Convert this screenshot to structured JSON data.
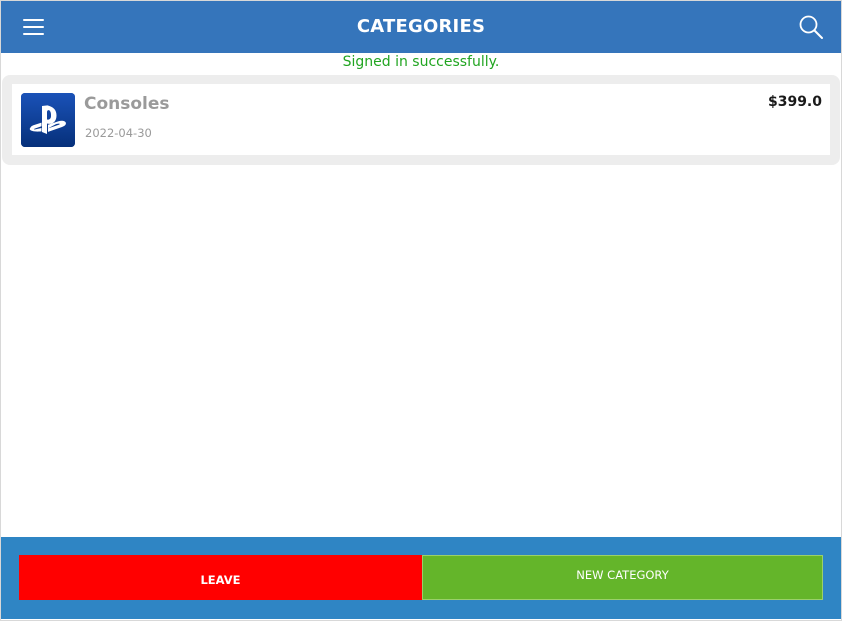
{
  "header": {
    "title": "CATEGORIES",
    "menu_icon": "hamburger-menu-icon",
    "search_icon": "search-icon",
    "background_color": "#3575bb"
  },
  "flash": {
    "message": "Signed in successfully.",
    "color": "#21a521"
  },
  "items": [
    {
      "name": "Consoles",
      "date": "2022-04-30",
      "price": "$399.0",
      "thumbnail_icon": "playstation-logo-icon"
    }
  ],
  "footer": {
    "leave_label": "LEAVE",
    "new_category_label": "NEW CATEGORY",
    "leave_color": "#ff0000",
    "new_category_color": "#64b52a",
    "background_color": "#2f85c4"
  }
}
